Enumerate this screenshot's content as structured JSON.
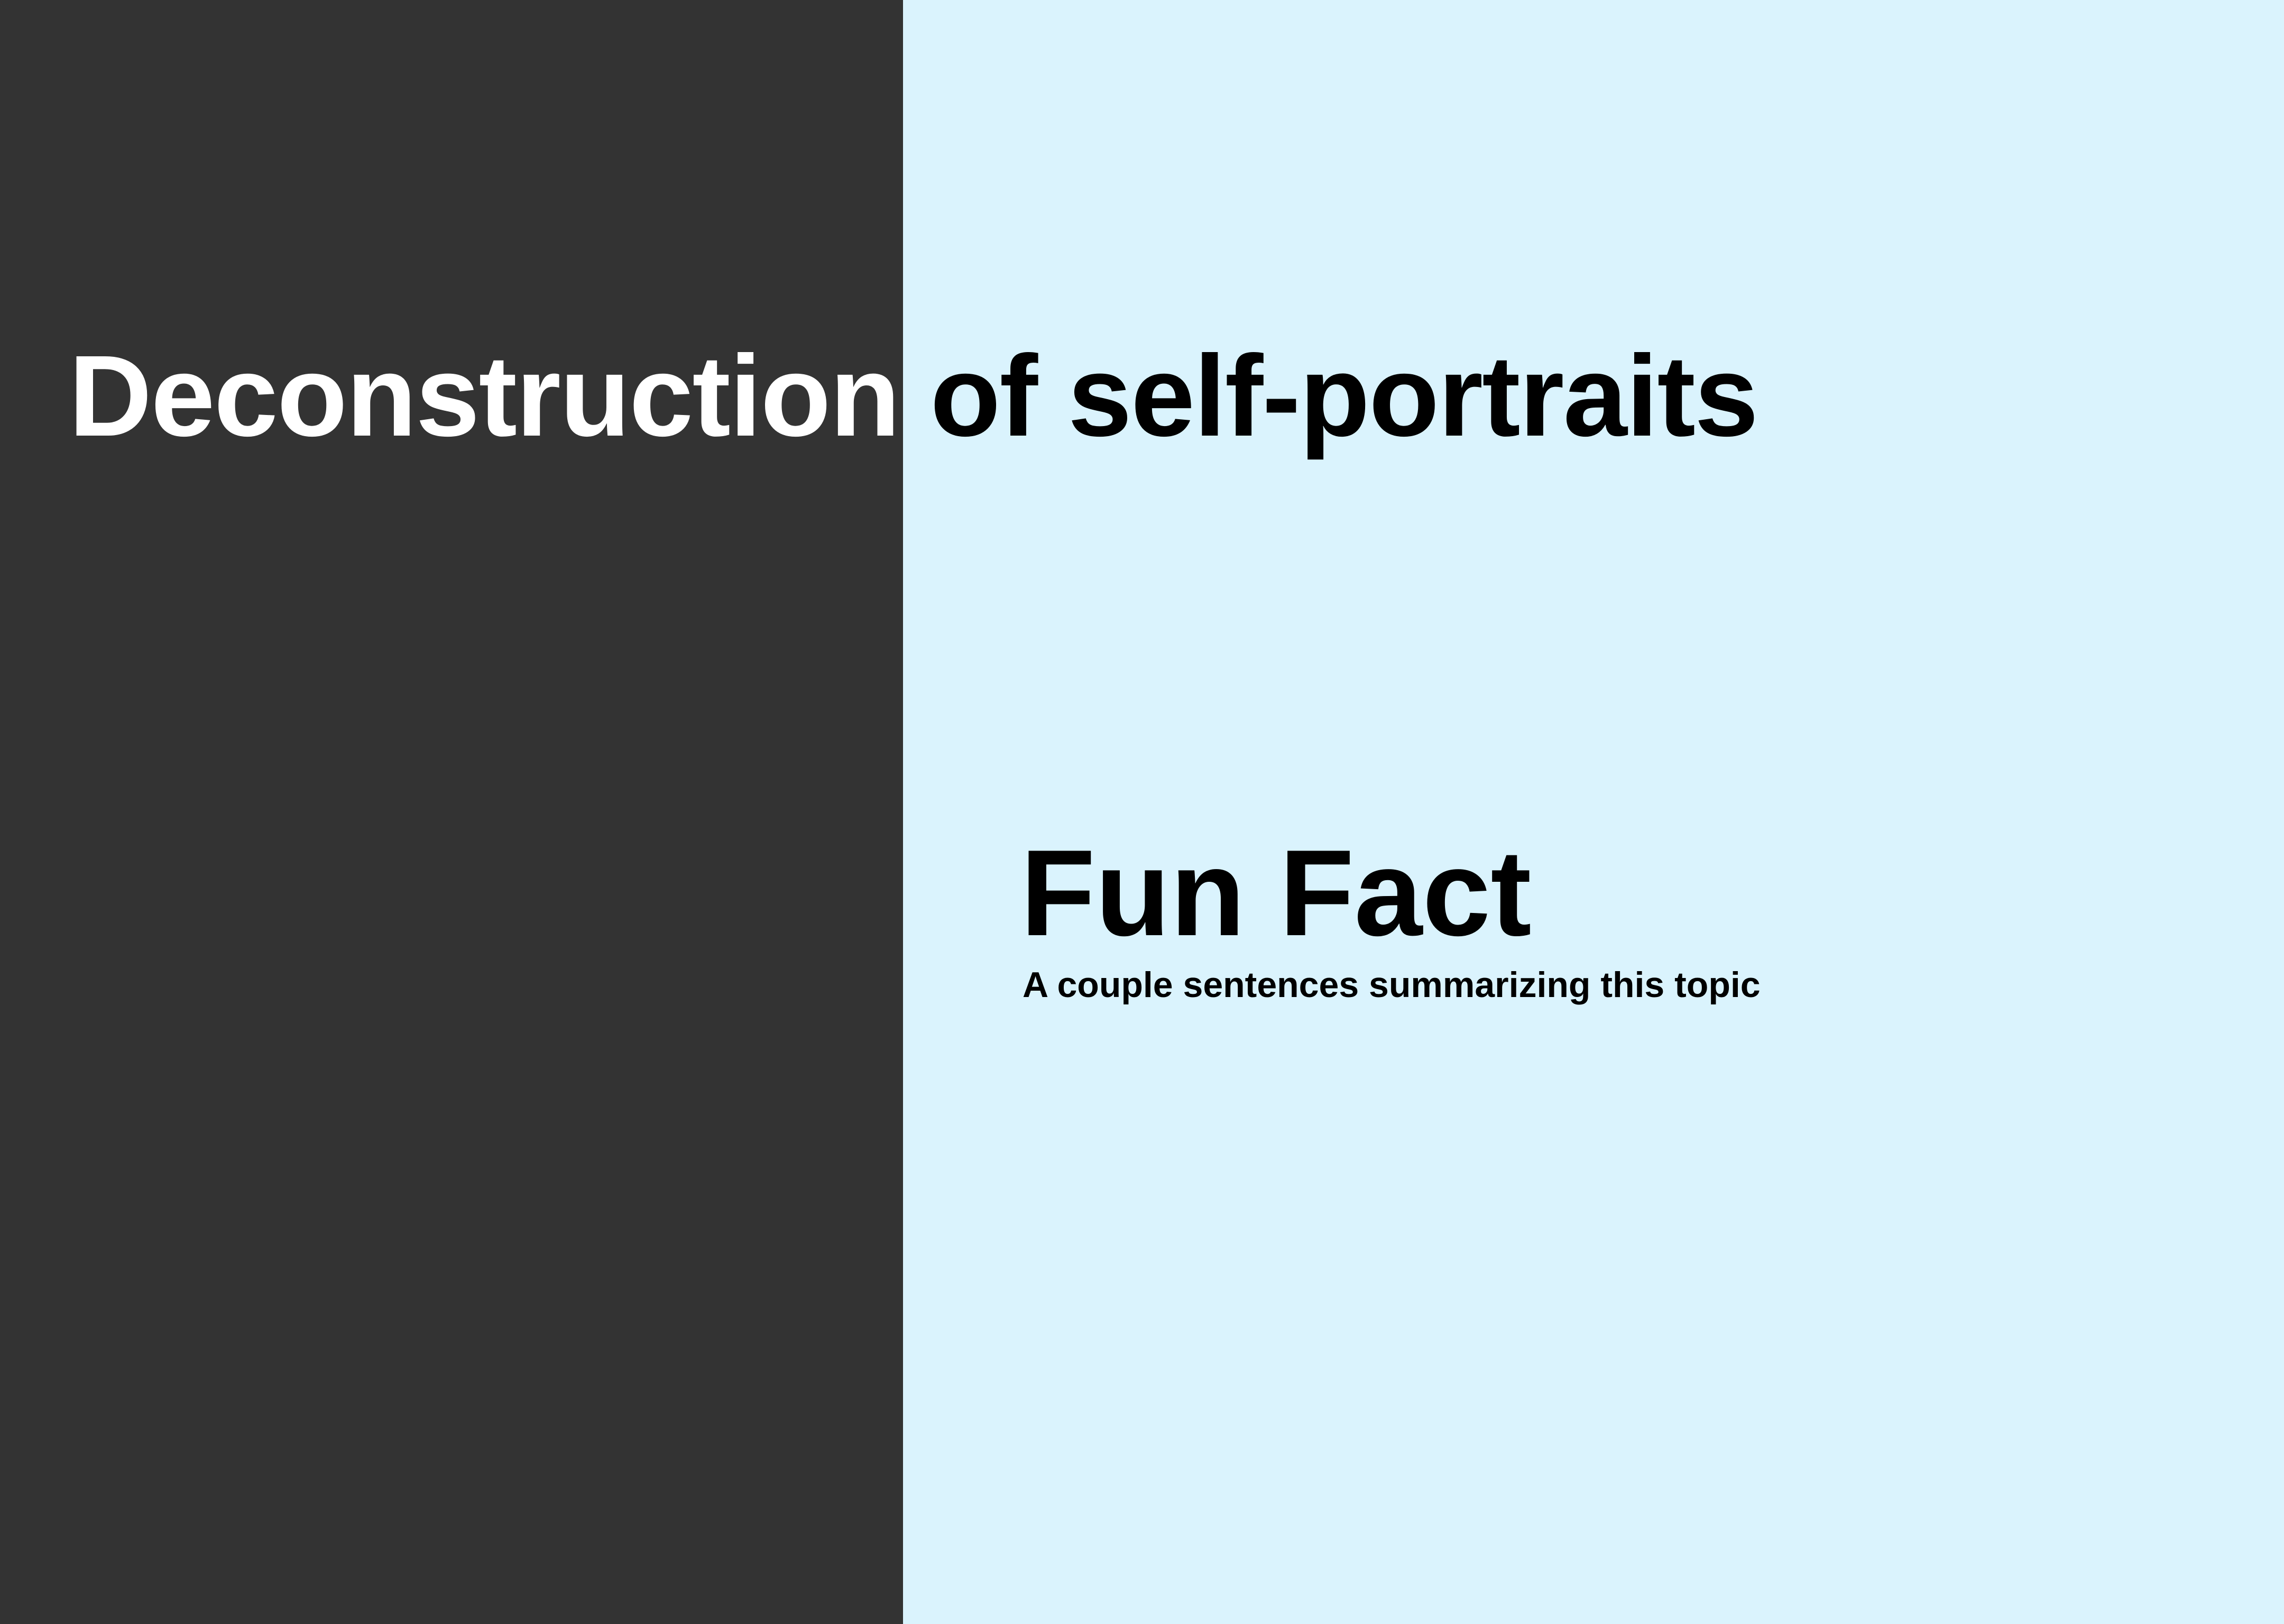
{
  "slide": {
    "title": "Deconstruction of self-portraits",
    "fun_fact": {
      "heading": "Fun Fact",
      "body": "A couple sentences summarizing this topic"
    }
  },
  "colors": {
    "dark_panel": "#333333",
    "light_panel": "#daf3fd",
    "title_on_dark": "#ffffff",
    "title_on_light": "#000000",
    "body_text": "#000000"
  }
}
